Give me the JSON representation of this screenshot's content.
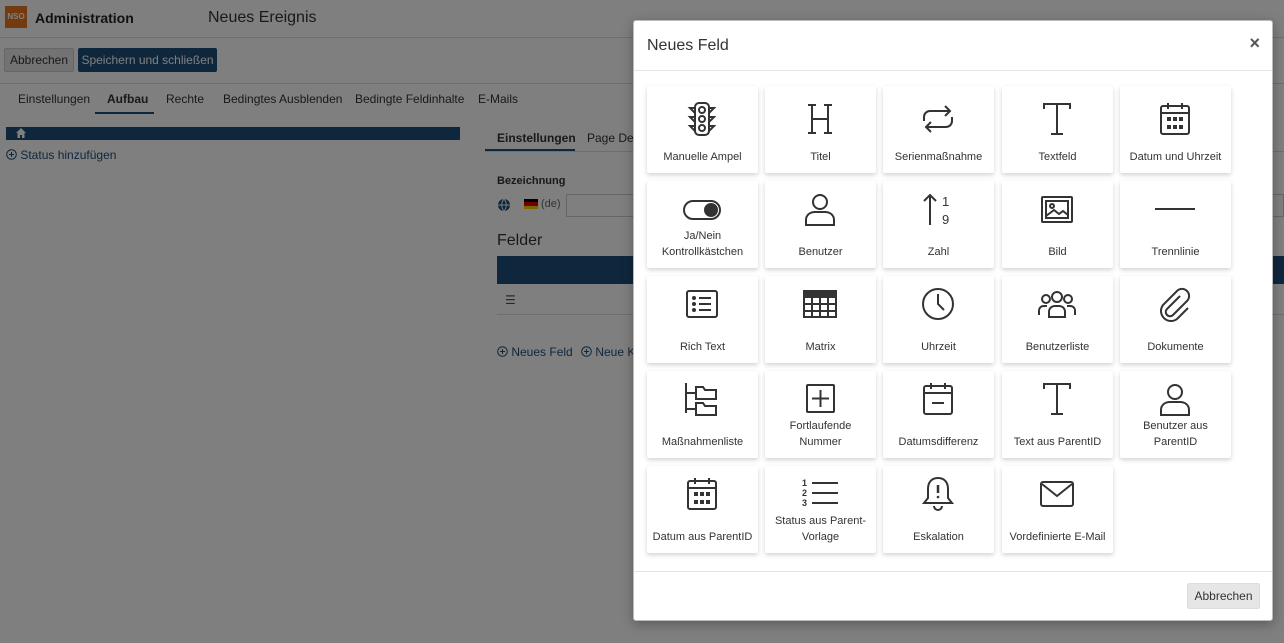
{
  "header": {
    "app_title": "Administration",
    "document_title": "Neues Ereignis",
    "logo_text": "NSO"
  },
  "toolbar": {
    "cancel_label": "Abbrechen",
    "save_close_label": "Speichern und schließen"
  },
  "main_tabs": [
    "Einstellungen",
    "Aufbau",
    "Rechte",
    "Bedingtes Ausblenden",
    "Bedingte Feldinhalte",
    "E-Mails"
  ],
  "left_panel": {
    "add_status_link": "Status hinzufügen"
  },
  "right_panel": {
    "subtabs": [
      "Einstellungen",
      "Page Des"
    ],
    "designation_label": "Bezeichnung",
    "language": "(de)",
    "fields_title": "Felder",
    "new_field_link": "Neues Feld",
    "new_category_link": "Neue Ka"
  },
  "modal": {
    "title": "Neues Feld",
    "close_symbol": "×",
    "cancel_label": "Abbrechen",
    "tiles": [
      {
        "label": "Manuelle Ampel",
        "icon": "traffic-light-icon"
      },
      {
        "label": "Titel",
        "icon": "heading-icon"
      },
      {
        "label": "Serienmaßnahme",
        "icon": "repeat-icon"
      },
      {
        "label": "Textfeld",
        "icon": "text-icon"
      },
      {
        "label": "Datum und Uhrzeit",
        "icon": "calendar-icon"
      },
      {
        "label": "Ja/Nein Kontrollkästchen",
        "icon": "toggle-icon"
      },
      {
        "label": "Benutzer",
        "icon": "user-icon"
      },
      {
        "label": "Zahl",
        "icon": "number-sort-icon"
      },
      {
        "label": "Bild",
        "icon": "image-icon"
      },
      {
        "label": "Trennlinie",
        "icon": "divider-line-icon"
      },
      {
        "label": "Rich Text",
        "icon": "list-box-icon"
      },
      {
        "label": "Matrix",
        "icon": "table-grid-icon"
      },
      {
        "label": "Uhrzeit",
        "icon": "clock-icon"
      },
      {
        "label": "Benutzerliste",
        "icon": "users-group-icon"
      },
      {
        "label": "Dokumente",
        "icon": "paperclip-icon"
      },
      {
        "label": "Maßnahmenliste",
        "icon": "folder-tree-icon"
      },
      {
        "label": "Fortlaufende Nummer",
        "icon": "plus-square-icon"
      },
      {
        "label": "Datumsdifferenz",
        "icon": "calendar-minus-icon"
      },
      {
        "label": "Text aus ParentID",
        "icon": "text-icon"
      },
      {
        "label": "Benutzer aus ParentID",
        "icon": "user-icon"
      },
      {
        "label": "Datum aus ParentID",
        "icon": "calendar-icon"
      },
      {
        "label": "Status aus Parent-Vorlage",
        "icon": "numbered-list-icon"
      },
      {
        "label": "Eskalation",
        "icon": "bell-alert-icon"
      },
      {
        "label": "Vordefinierte E-Mail",
        "icon": "envelope-icon"
      }
    ]
  }
}
